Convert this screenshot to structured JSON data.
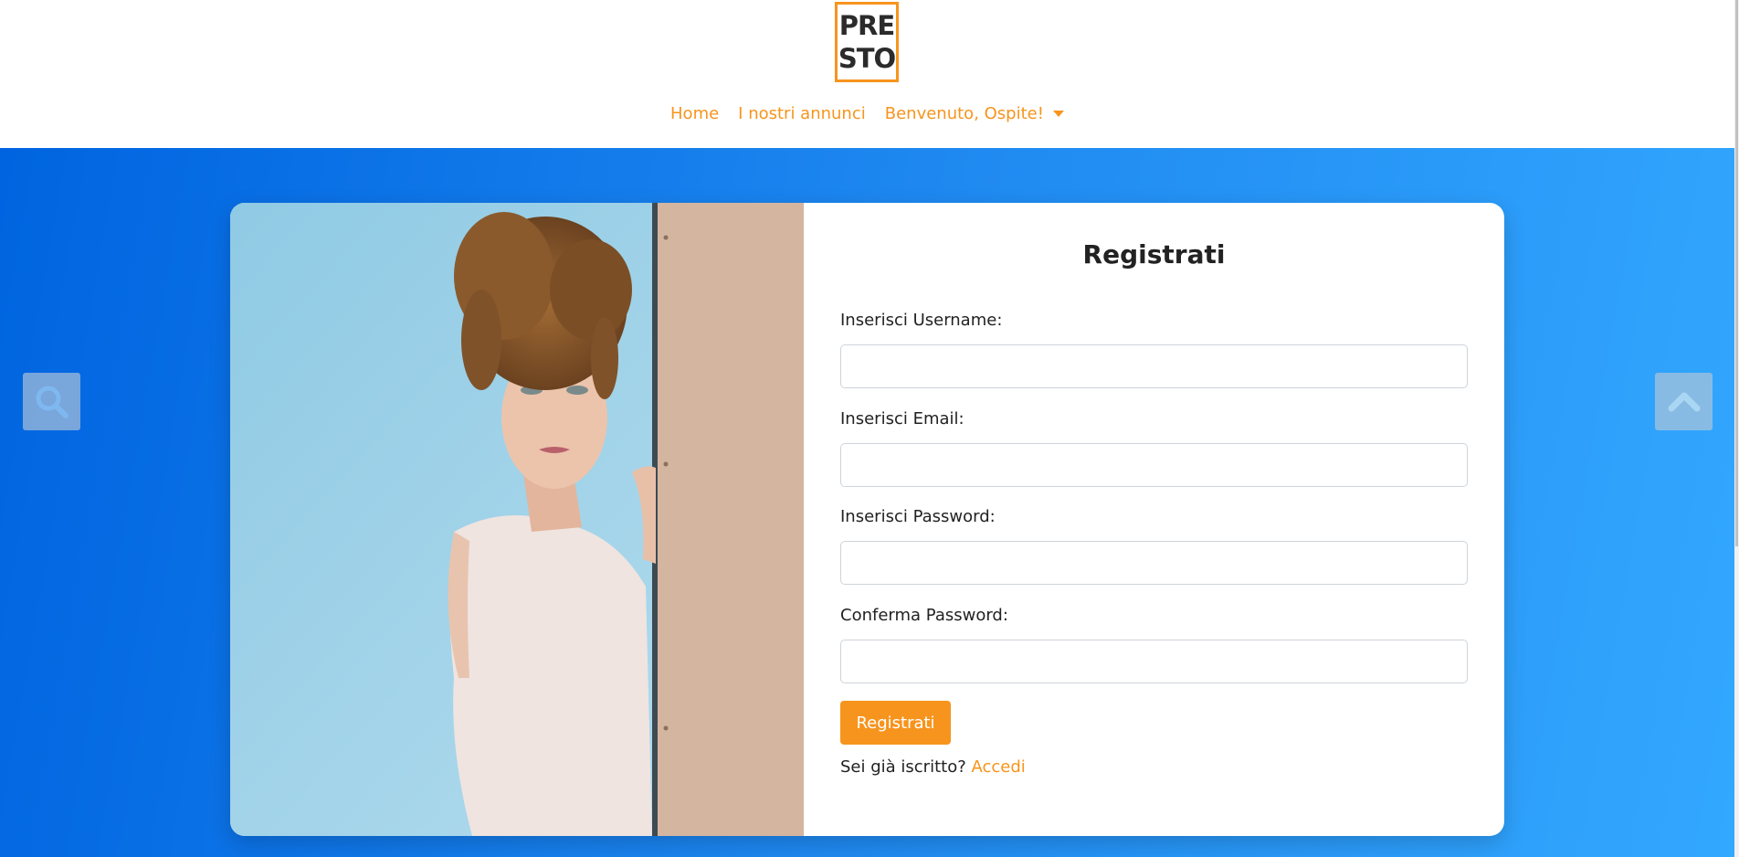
{
  "logo": {
    "line1": "PRE",
    "line2": "STO"
  },
  "nav": {
    "home": "Home",
    "listings": "I nostri annunci",
    "user_menu": "Benvenuto, Ospite!"
  },
  "form": {
    "title": "Registrati",
    "username_label": "Inserisci Username:",
    "email_label": "Inserisci Email:",
    "password_label": "Inserisci Password:",
    "confirm_label": "Conferma Password:",
    "username_value": "",
    "email_value": "",
    "password_value": "",
    "confirm_value": "",
    "submit_label": "Registrati",
    "login_prompt": "Sei già iscritto?",
    "login_link": "Accedi"
  },
  "icons": {
    "search": "search-icon",
    "scroll_top": "chevron-up-icon",
    "dropdown": "caret-down-icon"
  },
  "colors": {
    "accent": "#f7941d",
    "gradient_start": "#0064e0",
    "gradient_end": "#33a8ff"
  }
}
